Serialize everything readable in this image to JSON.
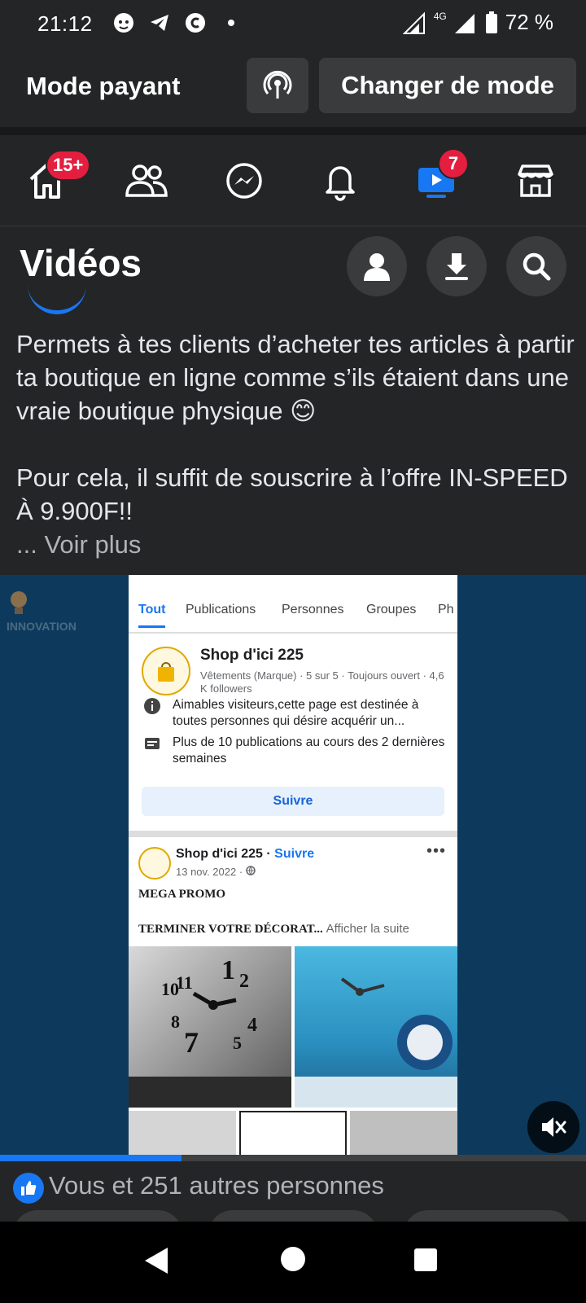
{
  "status_bar": {
    "time": "21:12",
    "network": "4G",
    "battery": "72 %",
    "icons": [
      "chat-bubble-icon",
      "telegram-icon",
      "threads-icon",
      "dot-icon"
    ]
  },
  "mode_bar": {
    "title": "Mode payant",
    "change_button": "Changer de mode"
  },
  "nav": {
    "home_badge": "15+",
    "video_badge": "7",
    "items": [
      "home-icon",
      "friends-icon",
      "messenger-icon",
      "bell-icon",
      "video-icon",
      "marketplace-icon"
    ]
  },
  "header": {
    "title": "Vidéos"
  },
  "post": {
    "paragraph1": "Permets à tes clients d’acheter tes articles à partir ta boutique en ligne comme s’ils étaient dans une vraie boutique physique 😊",
    "paragraph2": "Pour cela, il suffit de souscrire à l’offre IN-SPEED À 9.900F!!",
    "see_more": "... Voir plus"
  },
  "video": {
    "watermark": "INNOVATION",
    "progress": 0.31,
    "tabs": [
      "Tout",
      "Publications",
      "Personnes",
      "Groupes",
      "Ph"
    ],
    "shop": {
      "name": "Shop d'ici 225",
      "meta": "Vêtements (Marque) · 5 sur 5 · Toujours ouvert · 4,6 K followers",
      "info1": "Aimables visiteurs,cette page est destinée à toutes personnes qui désire acquérir un...",
      "info2": "Plus de 10 publications au cours des 2 dernières semaines",
      "follow": "Suivre"
    },
    "post": {
      "author": "Shop d'ici 225",
      "follow": "Suivre",
      "date": "13 nov. 2022 · ",
      "title": "MEGA PROMO",
      "line2": "TERMINER VOTRE DÉCORAT...",
      "more": "Afficher la suite"
    }
  },
  "reactions": {
    "text": "Vous et 251 autres personnes"
  },
  "colors": {
    "accent": "#1877f2",
    "badge": "#e41e3f",
    "background": "#242526"
  }
}
